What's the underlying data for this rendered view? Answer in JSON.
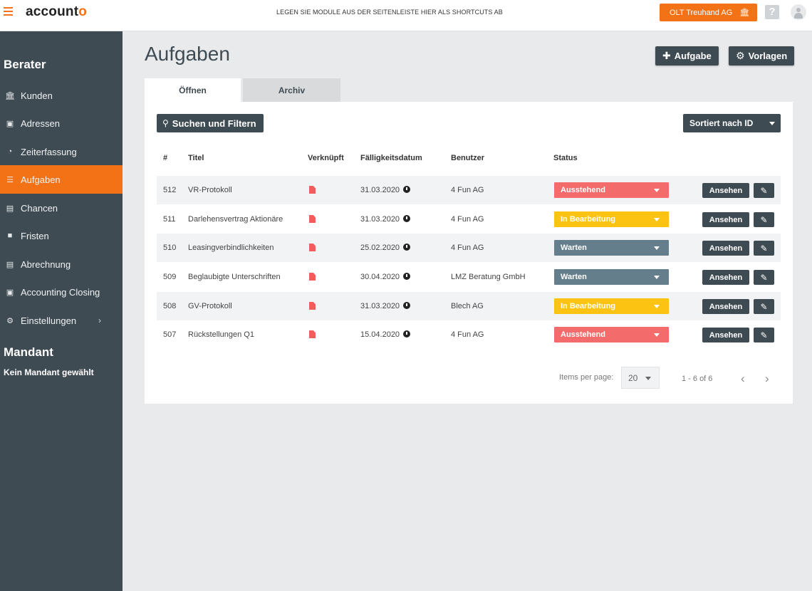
{
  "app": {
    "logo_main": "account",
    "logo_accent": "o",
    "shortcut_hint": "LEGEN SIE MODULE AUS DER SEITENLEISTE HIER ALS SHORTCUTS AB",
    "org_button": "OLT Treuhand AG",
    "help_label": "?"
  },
  "sidebar": {
    "section_berater": "Berater",
    "items": [
      {
        "label": "Kunden",
        "icon": "bank-icon"
      },
      {
        "label": "Adressen",
        "icon": "address-book-icon"
      },
      {
        "label": "Zeiterfassung",
        "icon": "clock-icon"
      },
      {
        "label": "Aufgaben",
        "icon": "tasks-icon"
      },
      {
        "label": "Chancen",
        "icon": "list-icon"
      },
      {
        "label": "Fristen",
        "icon": "briefcase-icon"
      },
      {
        "label": "Abrechnung",
        "icon": "invoice-icon"
      },
      {
        "label": "Accounting Closing",
        "icon": "book-icon"
      },
      {
        "label": "Einstellungen",
        "icon": "gear-icon"
      }
    ],
    "section_mandant": "Mandant",
    "mandant_note": "Kein Mandant gewählt"
  },
  "main": {
    "title": "Aufgaben",
    "add_button": "Aufgabe",
    "templates_button": "Vorlagen",
    "tabs": [
      {
        "label": "Öffnen",
        "active": true
      },
      {
        "label": "Archiv",
        "active": false
      }
    ],
    "search_button": "Suchen und Filtern",
    "sort_button": "Sortiert nach ID",
    "table": {
      "headers": [
        "#",
        "Titel",
        "Verknüpft",
        "Fälligkeitsdatum",
        "Benutzer",
        "Status"
      ],
      "rows": [
        {
          "id": "512",
          "title": "VR-Protokoll",
          "due": "31.03.2020",
          "user": "4 Fun AG",
          "status": "Ausstehend",
          "status_color": "#f46b6b"
        },
        {
          "id": "511",
          "title": "Darlehensvertrag Aktionäre",
          "due": "31.03.2020",
          "user": "4 Fun AG",
          "status": "In Bearbeitung",
          "status_color": "#fdc313"
        },
        {
          "id": "510",
          "title": "Leasingverbindlichkeiten",
          "due": "25.02.2020",
          "user": "4 Fun AG",
          "status": "Warten",
          "status_color": "#647e8b"
        },
        {
          "id": "509",
          "title": "Beglaubigte Unterschriften",
          "due": "30.04.2020",
          "user": "LMZ Beratung GmbH",
          "status": "Warten",
          "status_color": "#647e8b"
        },
        {
          "id": "508",
          "title": "GV-Protokoll",
          "due": "31.03.2020",
          "user": "Blech AG",
          "status": "In Bearbeitung",
          "status_color": "#fdc313"
        },
        {
          "id": "507",
          "title": "Rückstellungen Q1",
          "due": "15.04.2020",
          "user": "4 Fun AG",
          "status": "Ausstehend",
          "status_color": "#f46b6b"
        }
      ],
      "view_label": "Ansehen"
    },
    "pagination": {
      "items_per_page_label": "Items per page:",
      "items_per_page": "20",
      "range": "1 - 6 of 6"
    }
  },
  "colors": {
    "accent": "#f47216",
    "sidebar_bg": "#3f4b53",
    "button_dark": "#3f4b53"
  }
}
